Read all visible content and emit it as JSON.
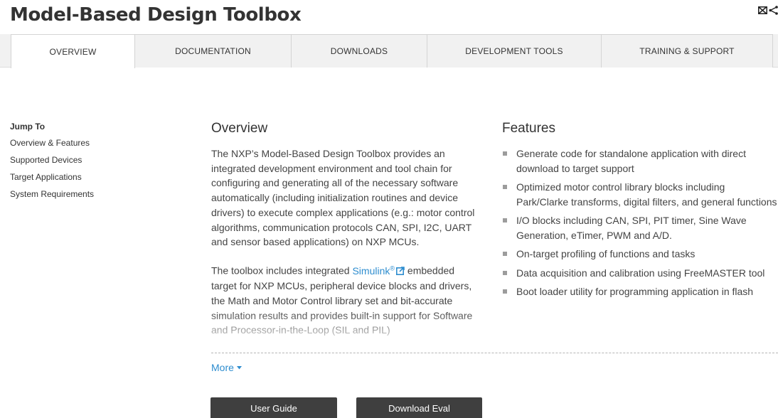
{
  "page": {
    "title": "Model-Based Design Toolbox",
    "share_icons": [
      "email-icon",
      "share-icon"
    ]
  },
  "tabs": [
    {
      "label": "OVERVIEW",
      "active": true
    },
    {
      "label": "DOCUMENTATION",
      "active": false
    },
    {
      "label": "DOWNLOADS",
      "active": false
    },
    {
      "label": "DEVELOPMENT TOOLS",
      "active": false
    },
    {
      "label": "TRAINING & SUPPORT",
      "active": false
    }
  ],
  "jump_to": {
    "title": "Jump To",
    "links": [
      "Overview & Features",
      "Supported Devices",
      "Target Applications",
      "System Requirements"
    ]
  },
  "overview": {
    "title": "Overview",
    "paragraph1": "The NXP’s Model-Based Design Toolbox provides an integrated development environment and tool chain for configuring and generating all of the necessary software automatically (including initialization routines and device drivers) to execute complex applications (e.g.: motor control algorithms, communication protocols CAN, SPI, I2C, UART and sensor based applications) on NXP MCUs.",
    "paragraph2_before_link": "The toolbox includes integrated ",
    "paragraph2_link": "Simulink",
    "paragraph2_link_sup": "®",
    "paragraph2_after_link": " embedded target for NXP MCUs, peripheral device blocks and drivers, the Math and Motor Control library set and bit-accurate simulation results and provides built-in support for Software and Processor-in-the-Loop (SIL and PIL)"
  },
  "features": {
    "title": "Features",
    "items": [
      "Generate code for standalone application with direct download to target support",
      "Optimized motor control library blocks including Park/Clarke transforms, digital filters, and general functions",
      "I/O blocks including CAN, SPI, PIT timer, Sine Wave Generation, eTimer, PWM and A/D.",
      "On-target profiling of functions and tasks",
      "Data acquisition and calibration using FreeMASTER tool",
      "Boot loader utility for programming application in flash"
    ]
  },
  "more_label": "More",
  "buttons": {
    "user_guide": "User Guide",
    "download_eval": "Download Eval"
  },
  "colors": {
    "link": "#2e8dcf",
    "button_bg": "#3f3f3f",
    "tabbar_bg": "#f1f1f1"
  }
}
